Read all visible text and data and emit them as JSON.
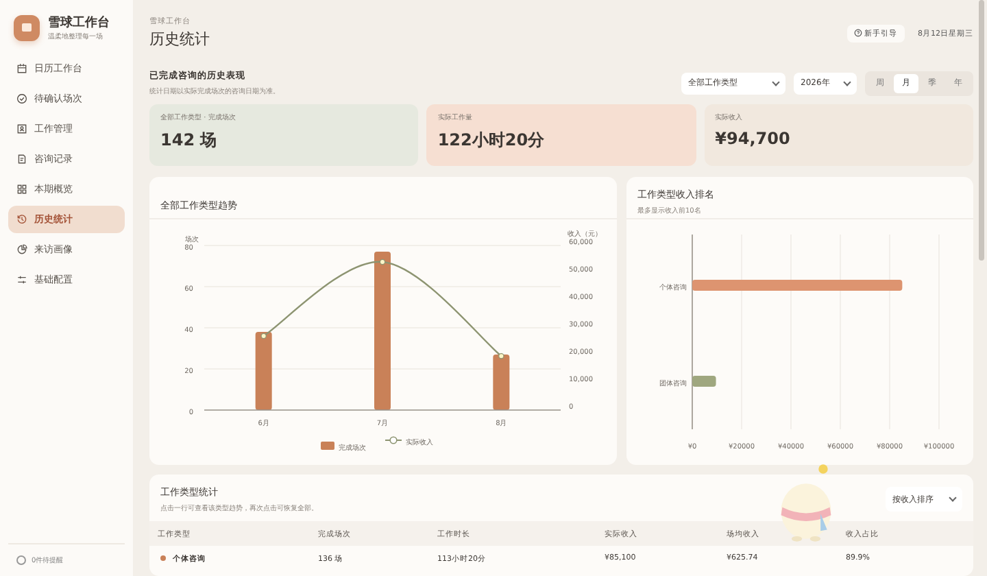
{
  "sidebar": {
    "brand": "雪球工作台",
    "brand_subtitle": "温柔地整理每一场",
    "items": [
      {
        "label": "日历工作台",
        "selected": false
      },
      {
        "label": "待确认场次",
        "selected": false
      },
      {
        "label": "工作管理",
        "selected": false
      },
      {
        "label": "咨询记录",
        "selected": false
      },
      {
        "label": "本期概览",
        "selected": false
      },
      {
        "label": "历史统计",
        "selected": true
      },
      {
        "label": "来访画像",
        "selected": false
      },
      {
        "label": "基础配置",
        "selected": false
      }
    ],
    "footer": "0件待提醒"
  },
  "header": {
    "breadcrumb": "雪球工作台",
    "title": "历史统计",
    "guide_button": "新手引导",
    "date": "8月12日星期三"
  },
  "section": {
    "title": "已完成咨询的历史表现",
    "subtitle": "统计日期以实际完成场次的咨询日期为准。",
    "type_select": "全部工作类型",
    "year_select": "2026年",
    "periods": [
      {
        "label": "周",
        "selected": false
      },
      {
        "label": "月",
        "selected": true
      },
      {
        "label": "季",
        "selected": false
      },
      {
        "label": "年",
        "selected": false
      }
    ]
  },
  "kpis": [
    {
      "label": "全部工作类型 · 完成场次",
      "value": "142 场",
      "color": "#e6e9df"
    },
    {
      "label": "实际工作量",
      "value": "122小时20分",
      "color": "#f6dfd2"
    },
    {
      "label": "实际收入",
      "value": "¥94,700",
      "color": "#f1e8de"
    }
  ],
  "trend": {
    "title": "全部工作类型趋势",
    "chart_data": {
      "type": "bar",
      "grid": true,
      "legend": "bottom",
      "categories": [
        "6月",
        "7月",
        "8月"
      ],
      "ylabel": "场次",
      "series": [
        {
          "name": "完成场次",
          "color": "#c98158",
          "values": [
            38,
            77,
            27
          ]
        }
      ],
      "ylim": [
        0,
        80
      ],
      "yticks": [
        0,
        20,
        40,
        60,
        80
      ]
    },
    "income_line": {
      "chart_data": {
        "type": "line",
        "legend": "bottom",
        "ylabel": "收入（元）",
        "series": [
          {
            "name": "实际收入",
            "color": "#8d9471",
            "marker": "circle",
            "values": [
              25000,
              52000,
              17700
            ]
          }
        ],
        "ylim": [
          0,
          60000
        ],
        "yticks": [
          {
            "value": 0,
            "label": "0"
          },
          {
            "value": 10000,
            "label": "10,000"
          },
          {
            "value": 20000,
            "label": "20,000"
          },
          {
            "value": 30000,
            "label": "30,000"
          },
          {
            "value": 40000,
            "label": "40,000"
          },
          {
            "value": 50000,
            "label": "50,000"
          },
          {
            "value": 60000,
            "label": "60,000"
          }
        ]
      }
    }
  },
  "ranking": {
    "title": "工作类型收入排名",
    "subtitle": "最多显示收入前10名",
    "chart_data": {
      "type": "bar",
      "orientation": "horizontal",
      "grid": true,
      "categories": [
        "个体咨询",
        "团体咨询"
      ],
      "values": [
        85100,
        9600
      ],
      "colors": [
        "#dd9470",
        "#9fa77f"
      ],
      "xlim": [
        0,
        100000
      ],
      "xticks": [
        {
          "value": 0,
          "label": "¥0"
        },
        {
          "value": 20000,
          "label": "¥20000"
        },
        {
          "value": 40000,
          "label": "¥40000"
        },
        {
          "value": 60000,
          "label": "¥60000"
        },
        {
          "value": 80000,
          "label": "¥80000"
        },
        {
          "value": 100000,
          "label": "¥100000"
        }
      ]
    }
  },
  "table": {
    "title": "工作类型统计",
    "subtitle": "点击一行可查看该类型趋势，再次点击可恢复全部。",
    "sort_select": "按收入排序",
    "columns": [
      "工作类型",
      "完成场次",
      "工作时长",
      "实际收入",
      "场均收入",
      "收入占比"
    ],
    "rows": [
      {
        "color": "#c98158",
        "cells": [
          "个体咨询",
          "136 场",
          "113小时20分",
          "¥85,100",
          "¥625.74",
          "89.9%"
        ]
      }
    ]
  }
}
